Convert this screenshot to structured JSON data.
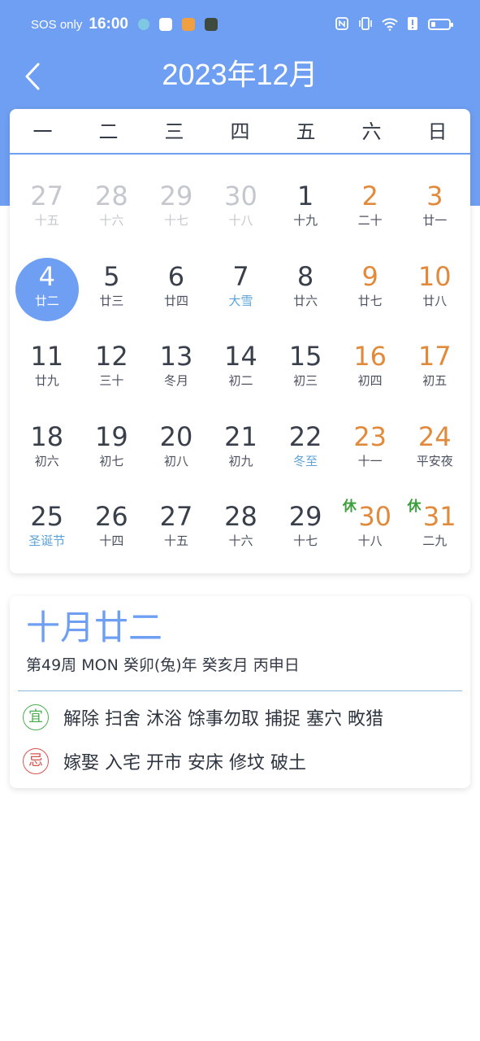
{
  "status_bar": {
    "carrier": "SOS only",
    "time": "16:00"
  },
  "header": {
    "month_title": "2023年12月"
  },
  "calendar": {
    "weekdays": [
      "一",
      "二",
      "三",
      "四",
      "五",
      "六",
      "日"
    ],
    "rows": [
      [
        {
          "num": "27",
          "lunar": "十五"
        },
        {
          "num": "28",
          "lunar": "十六"
        },
        {
          "num": "29",
          "lunar": "十七"
        },
        {
          "num": "30",
          "lunar": "十八"
        },
        {
          "num": "1",
          "lunar": "十九"
        },
        {
          "num": "2",
          "lunar": "二十"
        },
        {
          "num": "3",
          "lunar": "廿一"
        }
      ],
      [
        {
          "num": "4",
          "lunar": "廿二"
        },
        {
          "num": "5",
          "lunar": "廿三"
        },
        {
          "num": "6",
          "lunar": "廿四"
        },
        {
          "num": "7",
          "lunar": "大雪"
        },
        {
          "num": "8",
          "lunar": "廿六"
        },
        {
          "num": "9",
          "lunar": "廿七"
        },
        {
          "num": "10",
          "lunar": "廿八"
        }
      ],
      [
        {
          "num": "11",
          "lunar": "廿九"
        },
        {
          "num": "12",
          "lunar": "三十"
        },
        {
          "num": "13",
          "lunar": "冬月"
        },
        {
          "num": "14",
          "lunar": "初二"
        },
        {
          "num": "15",
          "lunar": "初三"
        },
        {
          "num": "16",
          "lunar": "初四"
        },
        {
          "num": "17",
          "lunar": "初五"
        }
      ],
      [
        {
          "num": "18",
          "lunar": "初六"
        },
        {
          "num": "19",
          "lunar": "初七"
        },
        {
          "num": "20",
          "lunar": "初八"
        },
        {
          "num": "21",
          "lunar": "初九"
        },
        {
          "num": "22",
          "lunar": "冬至"
        },
        {
          "num": "23",
          "lunar": "十一"
        },
        {
          "num": "24",
          "lunar": "平安夜"
        }
      ],
      [
        {
          "num": "25",
          "lunar": "圣诞节"
        },
        {
          "num": "26",
          "lunar": "十四"
        },
        {
          "num": "27",
          "lunar": "十五"
        },
        {
          "num": "28",
          "lunar": "十六"
        },
        {
          "num": "29",
          "lunar": "十七"
        },
        {
          "num": "30",
          "lunar": "十八"
        },
        {
          "num": "31",
          "lunar": "二九"
        }
      ]
    ],
    "rest_label": "休"
  },
  "detail": {
    "lunar_date": "十月廿二",
    "info": "第49周 MON 癸卯(兔)年 癸亥月 丙申日",
    "yi_label": "宜",
    "yi_items": "解除 扫舍 沐浴 馀事勿取 捕捉 塞穴 畋猎",
    "ji_label": "忌",
    "ji_items": "嫁娶 入宅 开市 安床 修坟 破土"
  },
  "colors": {
    "primary": "#6f9ff2",
    "weekend": "#e28a3b",
    "solar_term": "#5ba3d9",
    "rest": "#3e9e3e",
    "yi": "#4caf50",
    "ji": "#d9534f"
  }
}
